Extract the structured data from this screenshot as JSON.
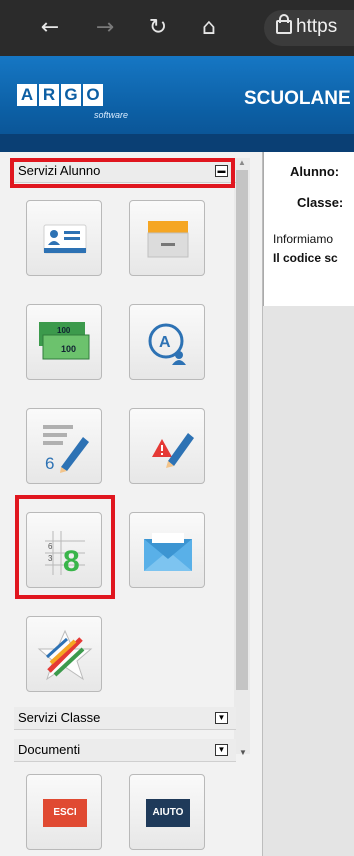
{
  "browser": {
    "url_partial": "https"
  },
  "banner": {
    "logo_letters": [
      "A",
      "R",
      "G",
      "O"
    ],
    "logo_sub": "software",
    "title": "SCUOLANE"
  },
  "sidebar": {
    "servizi_alunno": "Servizi Alunno",
    "servizi_classe": "Servizi Classe",
    "documenti": "Documenti",
    "tiles": [
      {
        "icon": "id-card-icon"
      },
      {
        "icon": "file-drawer-icon"
      },
      {
        "icon": "money-icon"
      },
      {
        "icon": "assenze-user-icon"
      },
      {
        "icon": "grade-pencil-icon"
      },
      {
        "icon": "warning-pencil-icon"
      },
      {
        "icon": "grade-8-icon"
      },
      {
        "icon": "envelope-icon"
      },
      {
        "icon": "star-ribbon-icon"
      }
    ],
    "doc_buttons": {
      "esci": "ESCI",
      "aiuto": "AIUTO"
    }
  },
  "content": {
    "alunno_label": "Alunno:",
    "classe_label": "Classe:",
    "info_line1": "Informiamo",
    "info_line2": "Il codice sc"
  },
  "colors": {
    "banner": "#0c5ea3",
    "highlight": "#e0161f",
    "esci": "#e04a32",
    "aiuto": "#1f3a5a"
  }
}
